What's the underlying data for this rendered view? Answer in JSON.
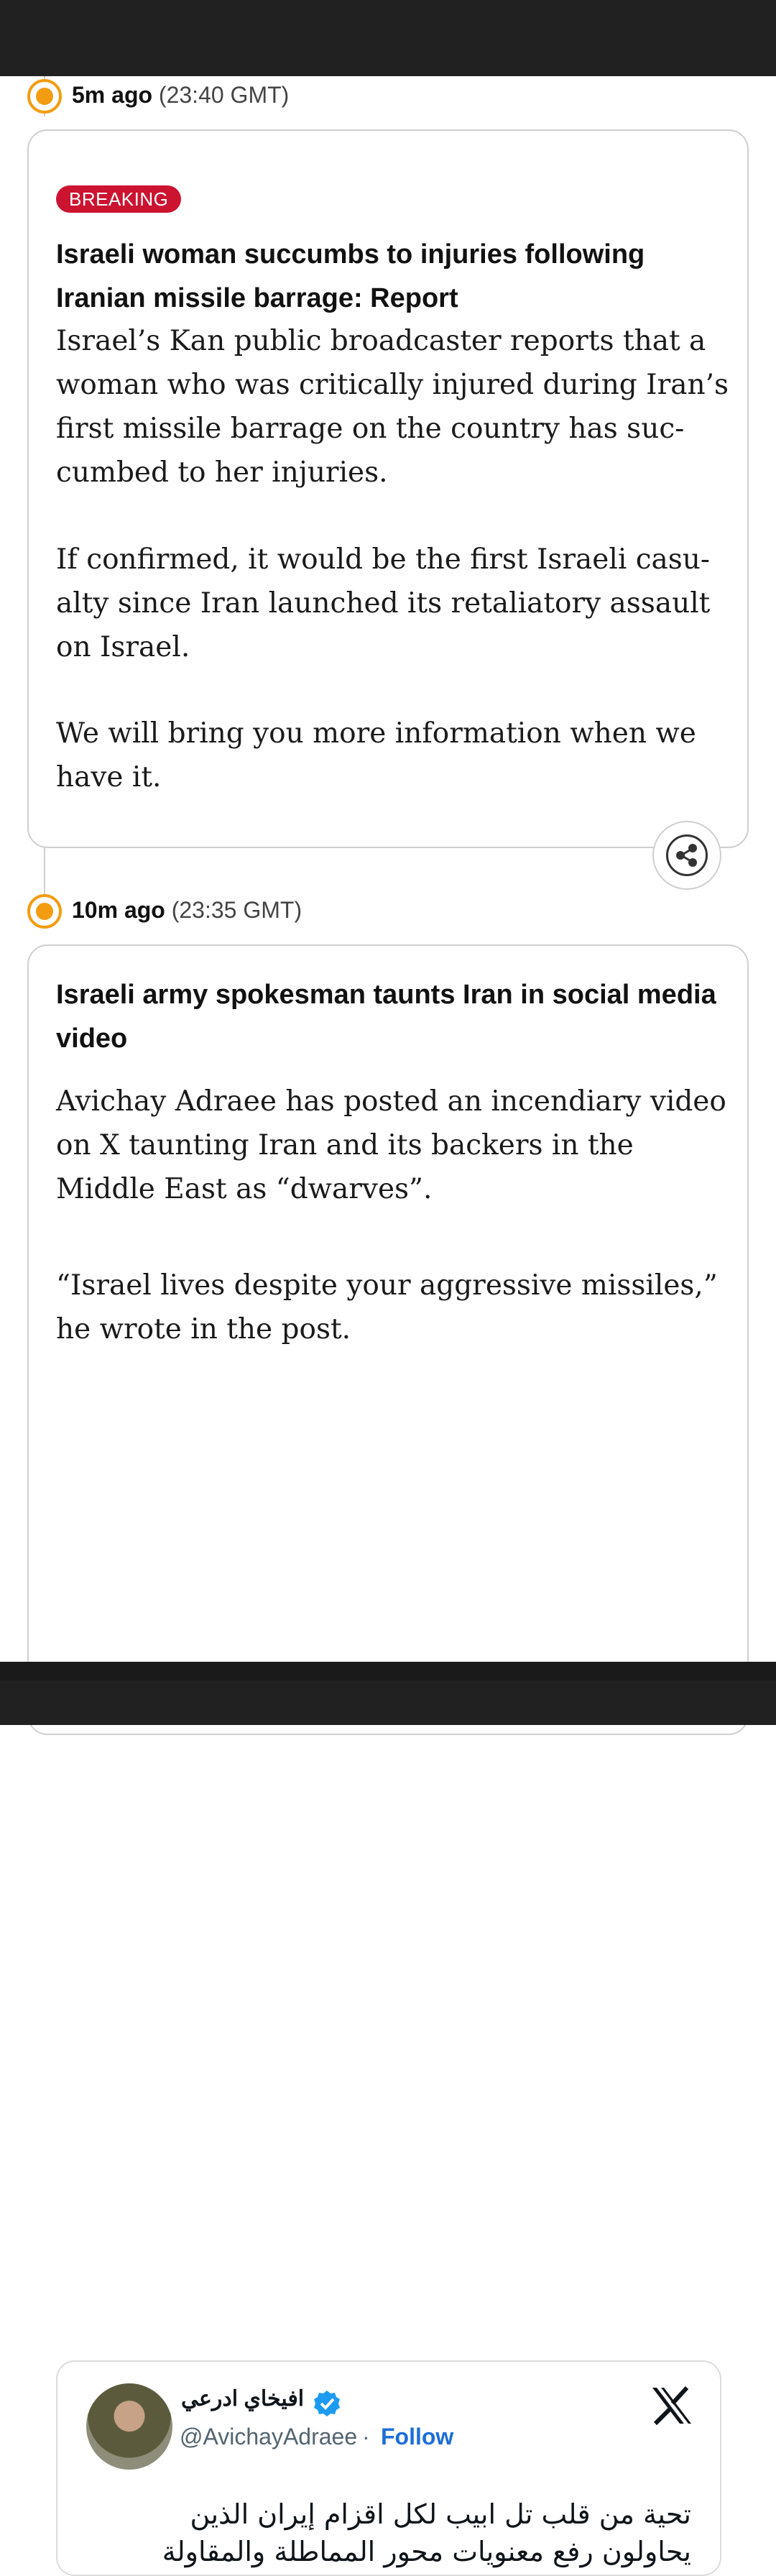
{
  "entries": [
    {
      "time_ago": "5m ago",
      "time_gmt": "(23:40 GMT)",
      "badge": "BREAKING",
      "headline": "Israeli woman succumbs to injuries following Iranian missile barrage: Report",
      "paragraphs": [
        "Israel’s Kan public broadcaster reports that a woman who was critically injured during Iran’s first missile barrage on the country has suc-cumbed to her injuries.",
        "If confirmed, it would be the first Israeli casu-alty since Iran launched its retaliatory assault on Israel.",
        "We will bring you more information when we have it."
      ]
    },
    {
      "time_ago": "10m ago",
      "time_gmt": "(23:35 GMT)",
      "headline": "Israeli army spokesman taunts Iran in social media video",
      "paragraphs": [
        "Avichay Adraee has posted an incendiary video on X taunting Iran and its backers in the Middle East as “dwarves”.",
        "“Israel lives despite your aggressive missiles,” he wrote in the post."
      ],
      "tweet": {
        "name": "افيخاي ادرعي",
        "handle": "@AvichayAdraee",
        "separator": "·",
        "follow": "Follow",
        "text": "تحية من قلب تل ابيب لكل اقزام إيران الذين يحاولون رفع معنويات محور المماطلة والمقاولة المهزومة. سنبقى شعب اسرائيل حي غصبًا عن"
      }
    }
  ],
  "colors": {
    "badge": "#cc1431",
    "timeline_dot": "#f39c12",
    "follow_link": "#1d6ed8",
    "verified": "#1d9bf0"
  },
  "icons": [
    "share-icon",
    "verified-icon",
    "x-logo-icon"
  ]
}
